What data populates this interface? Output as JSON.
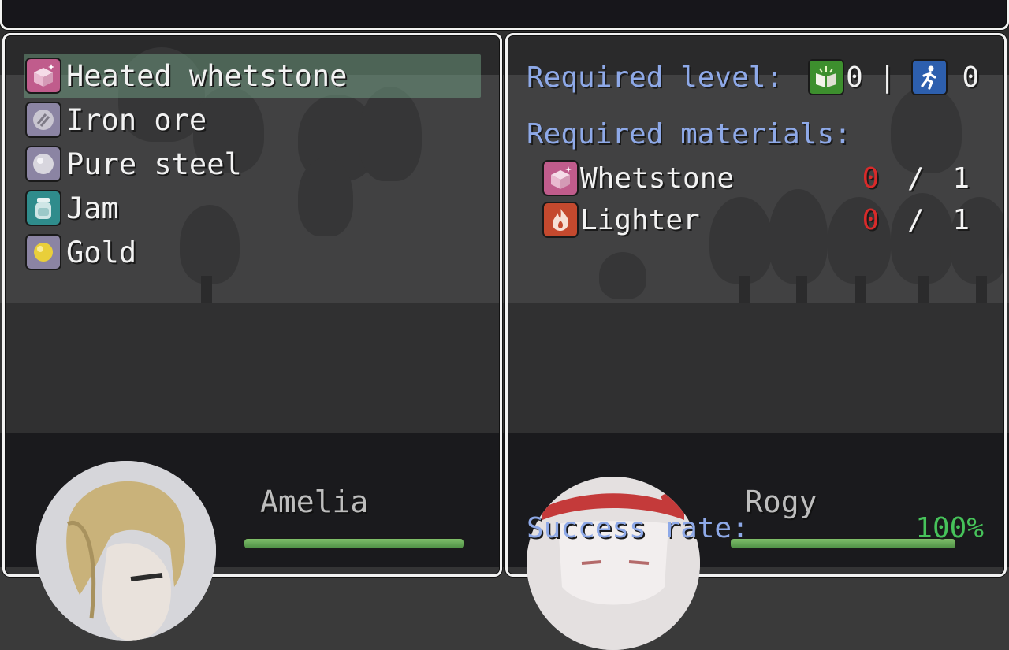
{
  "items": [
    {
      "label": "Heated whetstone",
      "icon": "sparkle-box-icon",
      "selected": true
    },
    {
      "label": "Iron ore",
      "icon": "ore-icon",
      "selected": false
    },
    {
      "label": "Pure steel",
      "icon": "steel-orb-icon",
      "selected": false
    },
    {
      "label": "Jam",
      "icon": "jar-icon",
      "selected": false
    },
    {
      "label": "Gold",
      "icon": "gold-orb-icon",
      "selected": false
    }
  ],
  "requirements": {
    "level_label": "Required level:",
    "crafting_level": "0",
    "separator": "|",
    "agility_level": "0",
    "materials_label": "Required materials:",
    "materials": [
      {
        "name": "Whetstone",
        "icon": "sparkle-box-icon",
        "have": "0",
        "slash": "/",
        "need": "1"
      },
      {
        "name": "Lighter",
        "icon": "flame-icon",
        "have": "0",
        "slash": "/",
        "need": "1"
      }
    ],
    "success_label": "Success rate:",
    "success_value": "100%"
  },
  "actors": [
    {
      "name": "Amelia",
      "hp_fraction": 1.0
    },
    {
      "name": "Rogy",
      "hp_fraction": 1.0
    }
  ],
  "colors": {
    "window_border": "#f2f2f2",
    "system_text": "#8ea9e8",
    "selection": "#78aa8c",
    "insufficient": "#d92a2a",
    "success": "#46c25a"
  }
}
